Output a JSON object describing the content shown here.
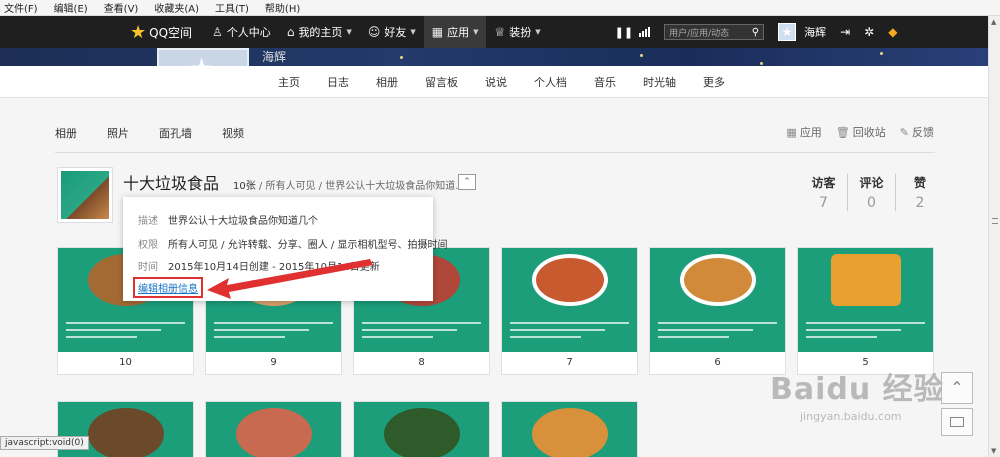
{
  "browser_menu": [
    "文件(F)",
    "编辑(E)",
    "查看(V)",
    "收藏夹(A)",
    "工具(T)",
    "帮助(H)"
  ],
  "topnav": {
    "logo": "QQ空间",
    "items": [
      {
        "label": "个人中心",
        "icon": "person-icon"
      },
      {
        "label": "我的主页",
        "icon": "home-icon",
        "caret": true
      },
      {
        "label": "好友",
        "icon": "friends-icon",
        "caret": true
      },
      {
        "label": "应用",
        "icon": "apps-grid-icon",
        "caret": true
      },
      {
        "label": "装扮",
        "icon": "shirt-icon",
        "caret": true
      }
    ],
    "search_placeholder": "用户/应用/动态",
    "username": "海辉"
  },
  "banner": {
    "name_fragment": "海辉"
  },
  "profile_tabs": [
    "主页",
    "日志",
    "相册",
    "留言板",
    "说说",
    "个人档",
    "音乐",
    "时光轴",
    "更多"
  ],
  "album_tabs": [
    "相册",
    "照片",
    "面孔墙",
    "视频"
  ],
  "actions": [
    {
      "label": "应用",
      "icon": "apps-icon"
    },
    {
      "label": "回收站",
      "icon": "trash-icon"
    },
    {
      "label": "反馈",
      "icon": "feedback-icon"
    }
  ],
  "album": {
    "title": "十大垃圾食品",
    "count": "10张",
    "visibility": "所有人可见",
    "desc_short": "世界公认十大垃圾食品你知道...",
    "stats": [
      {
        "label": "访客",
        "value": "7"
      },
      {
        "label": "评论",
        "value": "0"
      },
      {
        "label": "赞",
        "value": "2"
      }
    ]
  },
  "popup": {
    "desc_key": "描述",
    "desc_val": "世界公认十大垃圾食品你知道几个",
    "perm_key": "权限",
    "perm_val": "所有人可见 / 允许转载、分享、圈人 / 显示相机型号、拍摄时间",
    "time_key": "时间",
    "time_val": "2015年10月14日创建 - 2015年10月14日更新",
    "edit_link": "编辑相册信息"
  },
  "photos_row1": [
    "10",
    "9",
    "8",
    "7",
    "6",
    "5"
  ],
  "status_bar": "javascript:void(0)",
  "watermark": {
    "big": "Baidu 经验",
    "small": "jingyan.baidu.com"
  },
  "colors": {
    "teal": "#1c9e7b",
    "nav_bg": "#1f1f1f",
    "link": "#1a75c8",
    "highlight_red": "#e03030"
  }
}
